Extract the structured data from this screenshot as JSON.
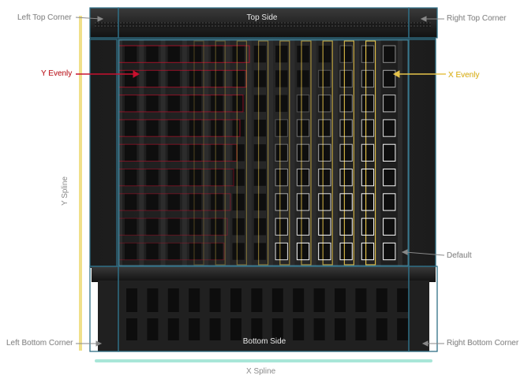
{
  "labels": {
    "left_top_corner": "Left Top Corner",
    "right_top_corner": "Right Top Corner",
    "top_side": "Top Side",
    "y_evenly": "Y Evenly",
    "x_evenly": "X Evenly",
    "y_spline": "Y Spline",
    "default": "Default",
    "left_bottom_corner": "Left Bottom Corner",
    "right_bottom_corner": "Right Bottom Corner",
    "bottom_side": "Bottom Side",
    "x_spline": "X Spline"
  },
  "colors": {
    "y_evenly": "#c8102e",
    "x_evenly": "#e6c34a",
    "region_outline": "#2f6f86",
    "y_spline": "#f0e08a",
    "x_spline": "#a8e6d8",
    "facade": "#1f1f1f"
  }
}
